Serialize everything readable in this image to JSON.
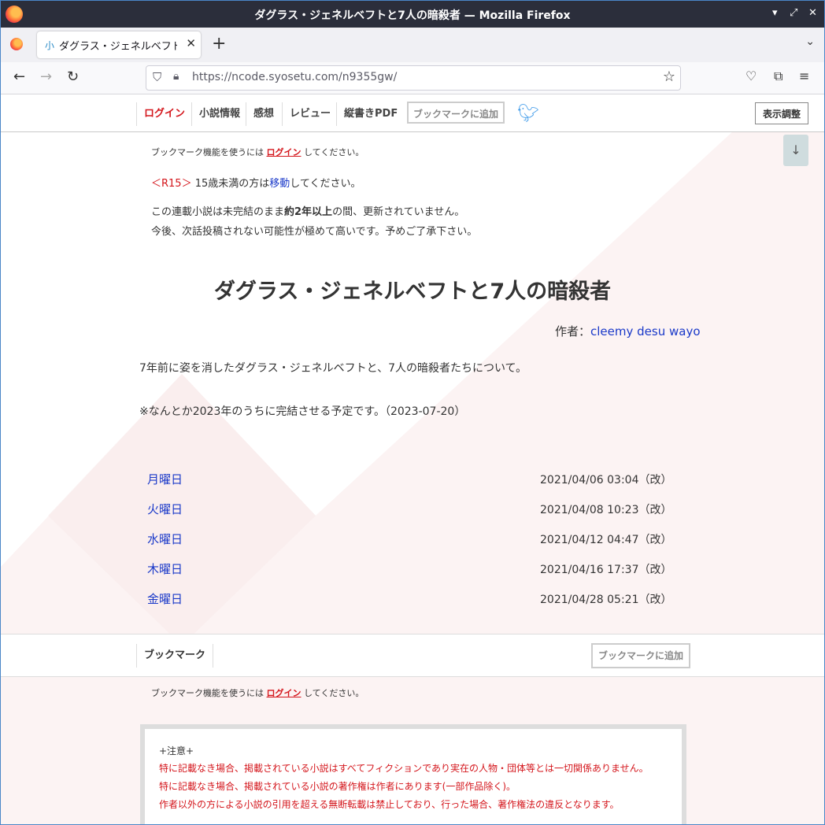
{
  "window": {
    "title": "ダグラス・ジェネルベフトと7人の暗殺者 — Mozilla Firefox"
  },
  "tab": {
    "favicon": "小",
    "label": "ダグラス・ジェネルベフトと7人の暗殺者"
  },
  "address": {
    "url": "https://ncode.syosetu.com/n9355gw/"
  },
  "topnav": {
    "login": "ログイン",
    "info": "小説情報",
    "impressions": "感想",
    "review": "レビュー",
    "pdf": "縦書きPDF",
    "bookmark_add": "ブックマークに追加",
    "display": "表示調整"
  },
  "notice_bookmark": {
    "prefix": "ブックマーク機能を使うには ",
    "login": "ログイン",
    "suffix": " してください。"
  },
  "r15": {
    "tag": "＜R15＞",
    "text1": " 15歳未満の方は",
    "link": "移動",
    "text2": "してください。"
  },
  "hiatus": {
    "line1_a": "この連載小説は未完結のまま",
    "line1_b": "約2年以上",
    "line1_c": "の間、更新されていません。",
    "line2": "今後、次話投稿されない可能性が極めて高いです。予めご了承下さい。"
  },
  "novel": {
    "title": "ダグラス・ジェネルベフトと7人の暗殺者",
    "author_label": "作者：",
    "author": "cleemy desu wayo",
    "summary1": "7年前に姿を消したダグラス・ジェネルベフトと、7人の暗殺者たちについて。",
    "summary2": "※なんとか2023年のうちに完結させる予定です。（2023-07-20）"
  },
  "chapters": [
    {
      "title": "月曜日",
      "date": "2021/04/06 03:04",
      "rev": "（改）"
    },
    {
      "title": "火曜日",
      "date": "2021/04/08 10:23",
      "rev": "（改）"
    },
    {
      "title": "水曜日",
      "date": "2021/04/12 04:47",
      "rev": "（改）"
    },
    {
      "title": "木曜日",
      "date": "2021/04/16 17:37",
      "rev": "（改）"
    },
    {
      "title": "金曜日",
      "date": "2021/04/28 05:21",
      "rev": "（改）"
    }
  ],
  "bottom": {
    "bookmark_label": "ブックマーク",
    "bookmark_add": "ブックマークに追加"
  },
  "caution": {
    "head": "+注意+",
    "l1": "特に記載なき場合、掲載されている小説はすべてフィクションであり実在の人物・団体等とは一切関係ありません。",
    "l2": "特に記載なき場合、掲載されている小説の著作権は作者にあります(一部作品除く)。",
    "l3": "作者以外の方による小説の引用を超える無断転載は禁止しており、行った場合、著作権法の違反となります。"
  },
  "colors": {
    "accent_red": "#d4161c",
    "link_blue": "#1a39c9",
    "twitter": "#4da2eb"
  }
}
